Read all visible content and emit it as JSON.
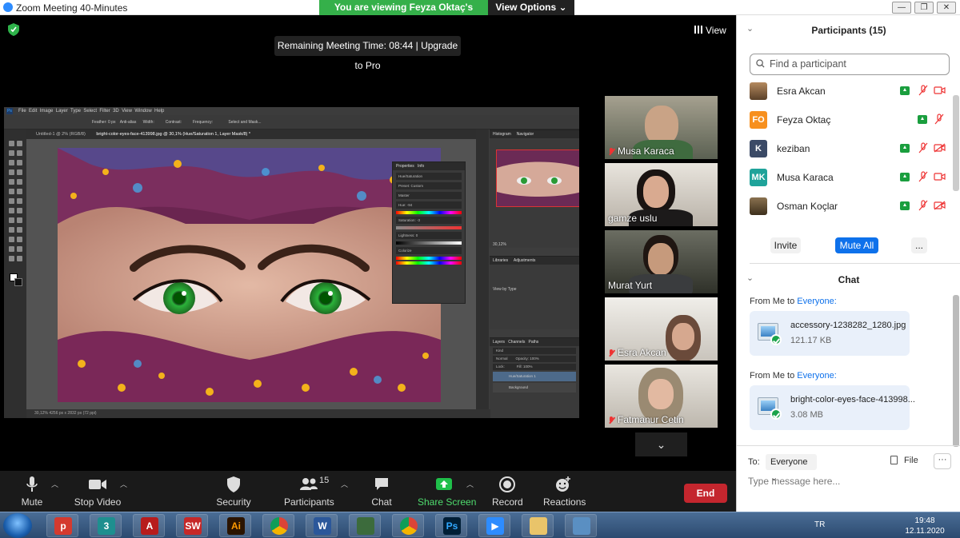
{
  "window": {
    "title": "Zoom Meeting 40-Minutes",
    "share_banner": "You are viewing Feyza Oktaç's screen",
    "view_options": "View Options"
  },
  "meeting": {
    "remaining_time": "Remaining Meeting Time: 08:44 | Upgrade to Pro",
    "view_label": "View",
    "scroll_down": "⌄"
  },
  "shared_screen": {
    "menu": [
      "File",
      "Edit",
      "Image",
      "Layer",
      "Type",
      "Select",
      "Filter",
      "3D",
      "View",
      "Window",
      "Help"
    ],
    "options": [
      "Feather: 0 px",
      "Anti-alias",
      "Width:",
      "Contrast:",
      "Frequency:",
      "Select and Mask..."
    ],
    "tabs": [
      "Untitled-1 @ 2% (RGB/8)",
      "bright-color-eyes-face-413998.jpg @ 30,1% (Hue/Saturation 1, Layer Mask/8) *"
    ],
    "status": "30,12%     4256 px x 2832 px (72 ppi)",
    "properties": {
      "tabs": [
        "Properties",
        "Info"
      ],
      "title": "Hue/Saturation",
      "preset_label": "Preset:",
      "preset": "Custom",
      "channel": "Master",
      "hue_label": "Hue:",
      "hue": "-94",
      "saturation_label": "Saturation:",
      "saturation": "-3",
      "lightness_label": "Lightness:",
      "lightness": "0",
      "colorize": "Colorize"
    },
    "right_tabs": [
      "Histogram",
      "Navigator"
    ],
    "zoom_readout": "30,12%",
    "libraries_tabs": [
      "Libraries",
      "Adjustments"
    ],
    "view_by": "View by Type",
    "layers_tabs": [
      "Layers",
      "Channels",
      "Paths"
    ],
    "layers_kind": "Kind",
    "blend_mode": "Normal",
    "opacity": "Opacity: 100%",
    "fill": "Fill: 100%",
    "lock": "Lock:",
    "layers": [
      "Hue/Saturation 1",
      "Background"
    ]
  },
  "participants_strip": [
    {
      "name": "Musa Karaca",
      "muted": true
    },
    {
      "name": "gamze uslu",
      "muted": false
    },
    {
      "name": "Murat Yurt",
      "muted": false
    },
    {
      "name": "Esra Akcan",
      "muted": true
    },
    {
      "name": "Fatmanur Cetin",
      "muted": true
    }
  ],
  "toolbar": {
    "mute": "Mute",
    "stop_video": "Stop Video",
    "security": "Security",
    "participants": "Participants",
    "participants_count": "15",
    "chat": "Chat",
    "share_screen": "Share Screen",
    "record": "Record",
    "reactions": "Reactions",
    "end": "End"
  },
  "panel": {
    "participants_title": "Participants (15)",
    "search_placeholder": "Find a participant",
    "participants": [
      {
        "name": "Esra Akcan",
        "avatar": "",
        "avatar_color": "#8b6b4a"
      },
      {
        "name": "Feyza Oktaç",
        "avatar": "FO",
        "avatar_color": "#f7901e"
      },
      {
        "name": "keziban",
        "avatar": "K",
        "avatar_color": "#3b4a66"
      },
      {
        "name": "Musa Karaca",
        "avatar": "MK",
        "avatar_color": "#1fa39a"
      },
      {
        "name": "Osman Koçlar",
        "avatar": "",
        "avatar_color": "#6e5a3a"
      }
    ],
    "invite": "Invite",
    "mute_all": "Mute All",
    "more": "...",
    "chat_title": "Chat",
    "messages": [
      {
        "from": "From Me to ",
        "to": "Everyone:",
        "file": "accessory-1238282_1280.jpg",
        "size": "121.17 KB"
      },
      {
        "from": "From Me to ",
        "to": "Everyone:",
        "file": "bright-color-eyes-face-413998...",
        "size": "3.08 MB"
      }
    ],
    "to_label": "To:",
    "to_value": "Everyone",
    "file_label": "File",
    "input_placeholder": "Type message here..."
  },
  "taskbar": {
    "language": "TR",
    "time": "19:48",
    "date": "12.11.2020"
  },
  "colors": {
    "zoom_blue": "#0e71eb",
    "share_green": "#35b04a",
    "end_red": "#c4262e",
    "mute_red": "#e33"
  }
}
